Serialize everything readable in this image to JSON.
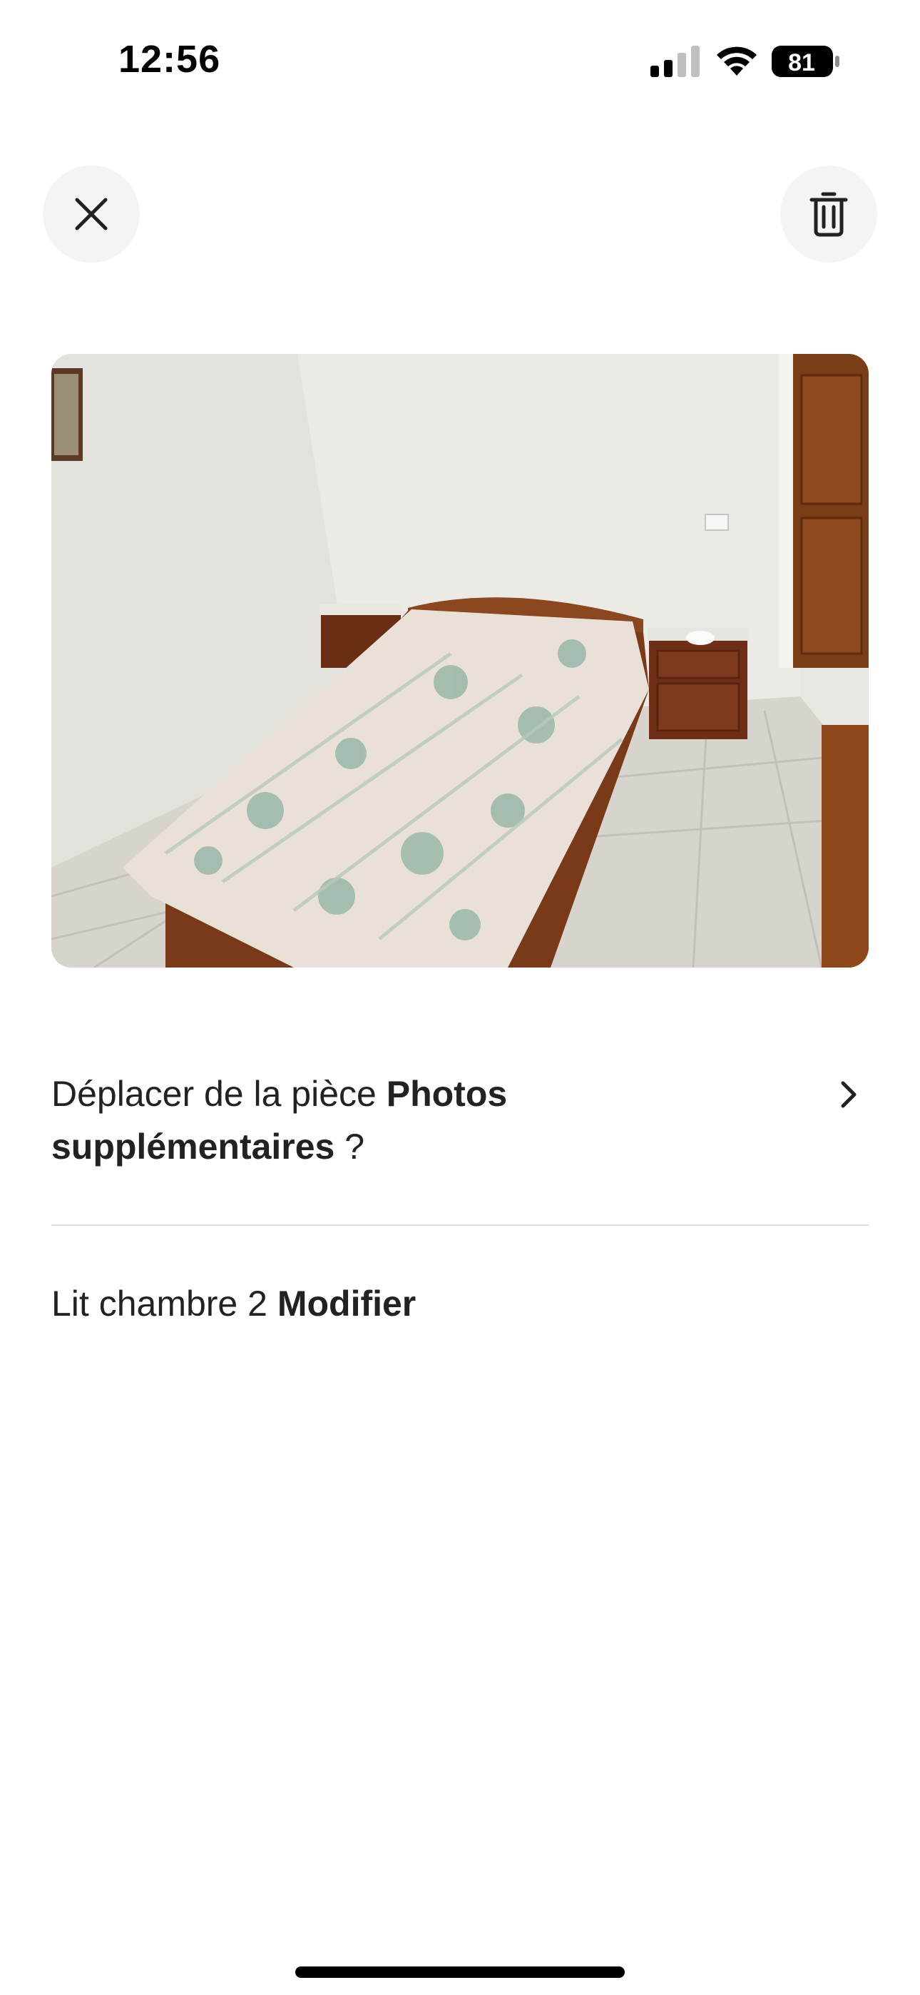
{
  "status_bar": {
    "time": "12:56",
    "battery_level": "81",
    "signal_icon": "cellular-signal-icon",
    "wifi_icon": "wifi-icon",
    "battery_icon": "battery-icon"
  },
  "header": {
    "close_icon": "close-icon",
    "delete_icon": "trash-icon"
  },
  "photo": {
    "subject": "bedroom photo"
  },
  "move": {
    "prefix": "Déplacer de la pièce ",
    "room": "Photos supplémentaires",
    "suffix": " ?",
    "chevron_icon": "chevron-right-icon"
  },
  "caption": {
    "text": "Lit chambre 2",
    "action": "Modifier"
  },
  "colors": {
    "text": "#222222",
    "divider": "#dddddd",
    "button_bg": "#f4f4f4"
  }
}
